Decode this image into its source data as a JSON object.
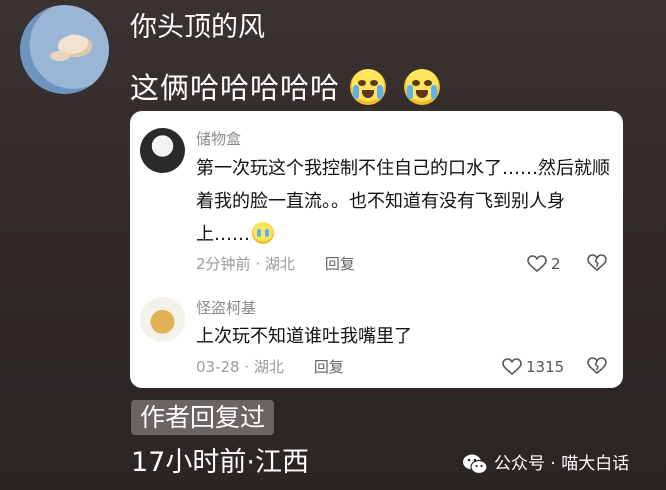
{
  "comment": {
    "username": "你头顶的风",
    "text": "这俩哈哈哈哈哈",
    "emojis": [
      "crying-laughing-emoji",
      "crying-laughing-emoji"
    ],
    "author_badge": "作者回复过",
    "time_location": "17小时前·江西"
  },
  "replies": [
    {
      "name": "储物盒",
      "text": "第一次玩这个我控制不住自己的口水了……然后就顺着我的脸一直流。。也不知道有没有飞到别人身上……",
      "time": "2分钟前",
      "location": "湖北",
      "reply_label": "回复",
      "likes": "2"
    },
    {
      "name": "怪盗柯基",
      "text": "上次玩不知道谁吐我嘴里了",
      "time": "03-28",
      "location": "湖北",
      "reply_label": "回复",
      "likes": "1315"
    }
  ],
  "watermark": "公众号 · 喵大白话",
  "meta_separator": " · "
}
